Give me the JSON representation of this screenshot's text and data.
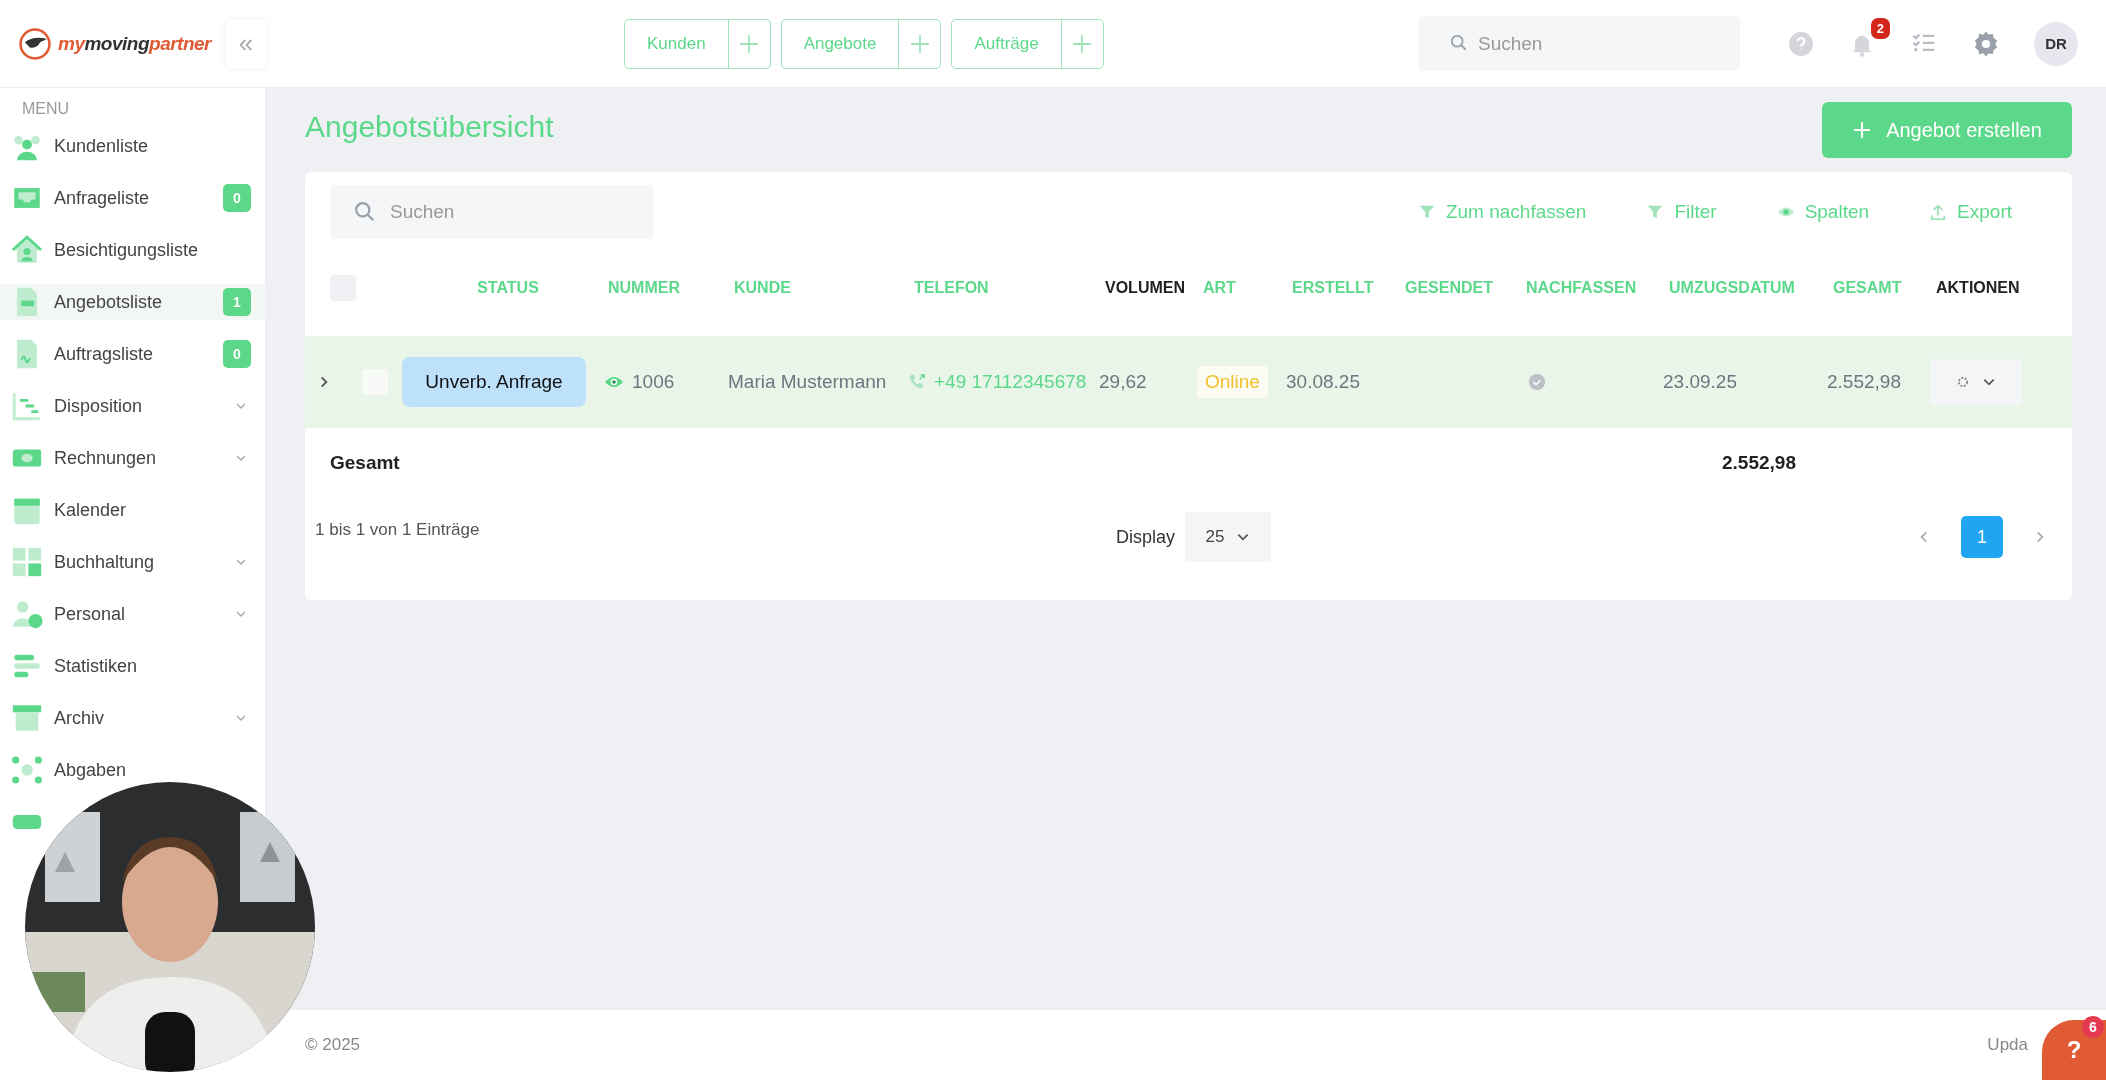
{
  "logo": {
    "parts": [
      {
        "text": "my",
        "accent": true
      },
      {
        "text": "moving",
        "accent": false
      },
      {
        "text": "partner",
        "accent": true
      }
    ]
  },
  "collapse_button": "«",
  "quick_actions": [
    {
      "label": "Kunden"
    },
    {
      "label": "Angebote"
    },
    {
      "label": "Aufträge"
    }
  ],
  "header_search": {
    "placeholder": "Suchen"
  },
  "notifications": {
    "count": "2"
  },
  "avatar": "DR",
  "sidebar": {
    "heading": "MENU",
    "items": [
      {
        "label": "Kundenliste",
        "selected": false,
        "expandable": false
      },
      {
        "label": "Anfrageliste",
        "badge": "0",
        "selected": false,
        "expandable": false
      },
      {
        "label": "Besichtigungsliste",
        "selected": false,
        "expandable": false
      },
      {
        "label": "Angebotsliste",
        "badge": "1",
        "selected": true,
        "expandable": false
      },
      {
        "label": "Auftragsliste",
        "badge": "0",
        "selected": false,
        "expandable": false
      },
      {
        "label": "Disposition",
        "selected": false,
        "expandable": true
      },
      {
        "label": "Rechnungen",
        "selected": false,
        "expandable": true
      },
      {
        "label": "Kalender",
        "selected": false,
        "expandable": false
      },
      {
        "label": "Buchhaltung",
        "selected": false,
        "expandable": true
      },
      {
        "label": "Personal",
        "selected": false,
        "expandable": true
      },
      {
        "label": "Statistiken",
        "selected": false,
        "expandable": false
      },
      {
        "label": "Archiv",
        "selected": false,
        "expandable": true
      },
      {
        "label": "Abgaben",
        "selected": false,
        "expandable": false
      },
      {
        "selected": false,
        "expandable": false
      }
    ]
  },
  "page_title": "Angebotsübersicht",
  "create_button": "Angebot erstellen",
  "table_search": {
    "placeholder": "Suchen"
  },
  "toolbar": [
    {
      "kind": "filter",
      "label": "Zum nachfassen"
    },
    {
      "kind": "filter",
      "label": "Filter"
    },
    {
      "kind": "eye",
      "label": "Spalten"
    },
    {
      "kind": "export",
      "label": "Export"
    }
  ],
  "select_all": {
    "checked": false
  },
  "table": {
    "columns": [
      {
        "label": "STATUS",
        "sortable": true
      },
      {
        "label": "NUMMER",
        "sortable": true
      },
      {
        "label": "KUNDE",
        "sortable": true
      },
      {
        "label": "TELEFON",
        "sortable": true
      },
      {
        "label": "VOLUMEN",
        "sortable": false
      },
      {
        "label": "ART",
        "sortable": true
      },
      {
        "label": "ERSTELLT",
        "sortable": true
      },
      {
        "label": "GESENDET",
        "sortable": true
      },
      {
        "label": "NACHFASSEN",
        "sortable": true
      },
      {
        "label": "UMZUGSDATUM",
        "sortable": true
      },
      {
        "label": "GESAMT",
        "sortable": true
      },
      {
        "label": "AKTIONEN",
        "sortable": false
      }
    ],
    "rows": [
      {
        "status": "Unverb. Anfrage",
        "nummer": "1006",
        "kunde": "Maria Mustermann",
        "telefon": "+49 17112345678",
        "volumen": "29,62",
        "art": "Online",
        "erstellt": "30.08.25",
        "nachfassen": true,
        "umzugsdatum": "23.09.25",
        "gesamt": "2.552,98",
        "selected": false,
        "checked": false
      }
    ],
    "total_label": "Gesamt",
    "total": "2.552,98"
  },
  "entries_info": "1 bis 1 von 1 Einträge",
  "page_size": {
    "label": "Display",
    "value": "25"
  },
  "pages": [
    {
      "label": "1",
      "selected": true
    }
  ],
  "footer": {
    "copyright": "© 2025",
    "right_text": "Upda"
  },
  "help_button": {
    "label": "?",
    "badge": "6"
  }
}
